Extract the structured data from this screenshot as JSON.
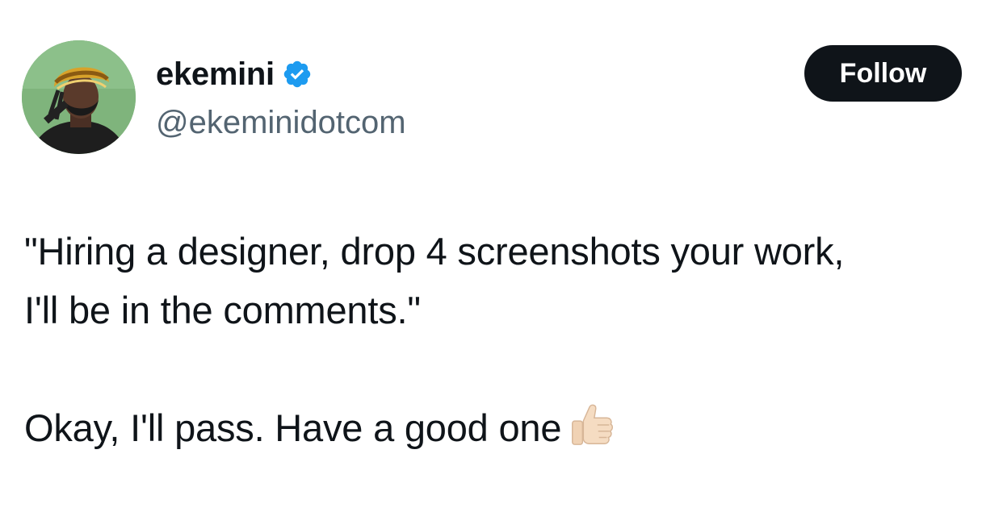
{
  "author": {
    "display_name": "ekemini",
    "handle": "@ekeminidotcom",
    "verified": true,
    "avatar_icon": "profile-photo",
    "verified_icon": "verified-badge-icon",
    "verified_color": "#1d9bf0"
  },
  "actions": {
    "follow_label": "Follow",
    "follow_bg": "#0f1419"
  },
  "tweet": {
    "lines": [
      "\"Hiring a designer, drop 4 screenshots your work,",
      "I'll be in the comments.\""
    ],
    "closing": "Okay, I'll pass. Have a good one",
    "emoji": "👍🏻"
  },
  "colors": {
    "text": "#0f1419",
    "secondary": "#536471",
    "background": "#ffffff"
  }
}
